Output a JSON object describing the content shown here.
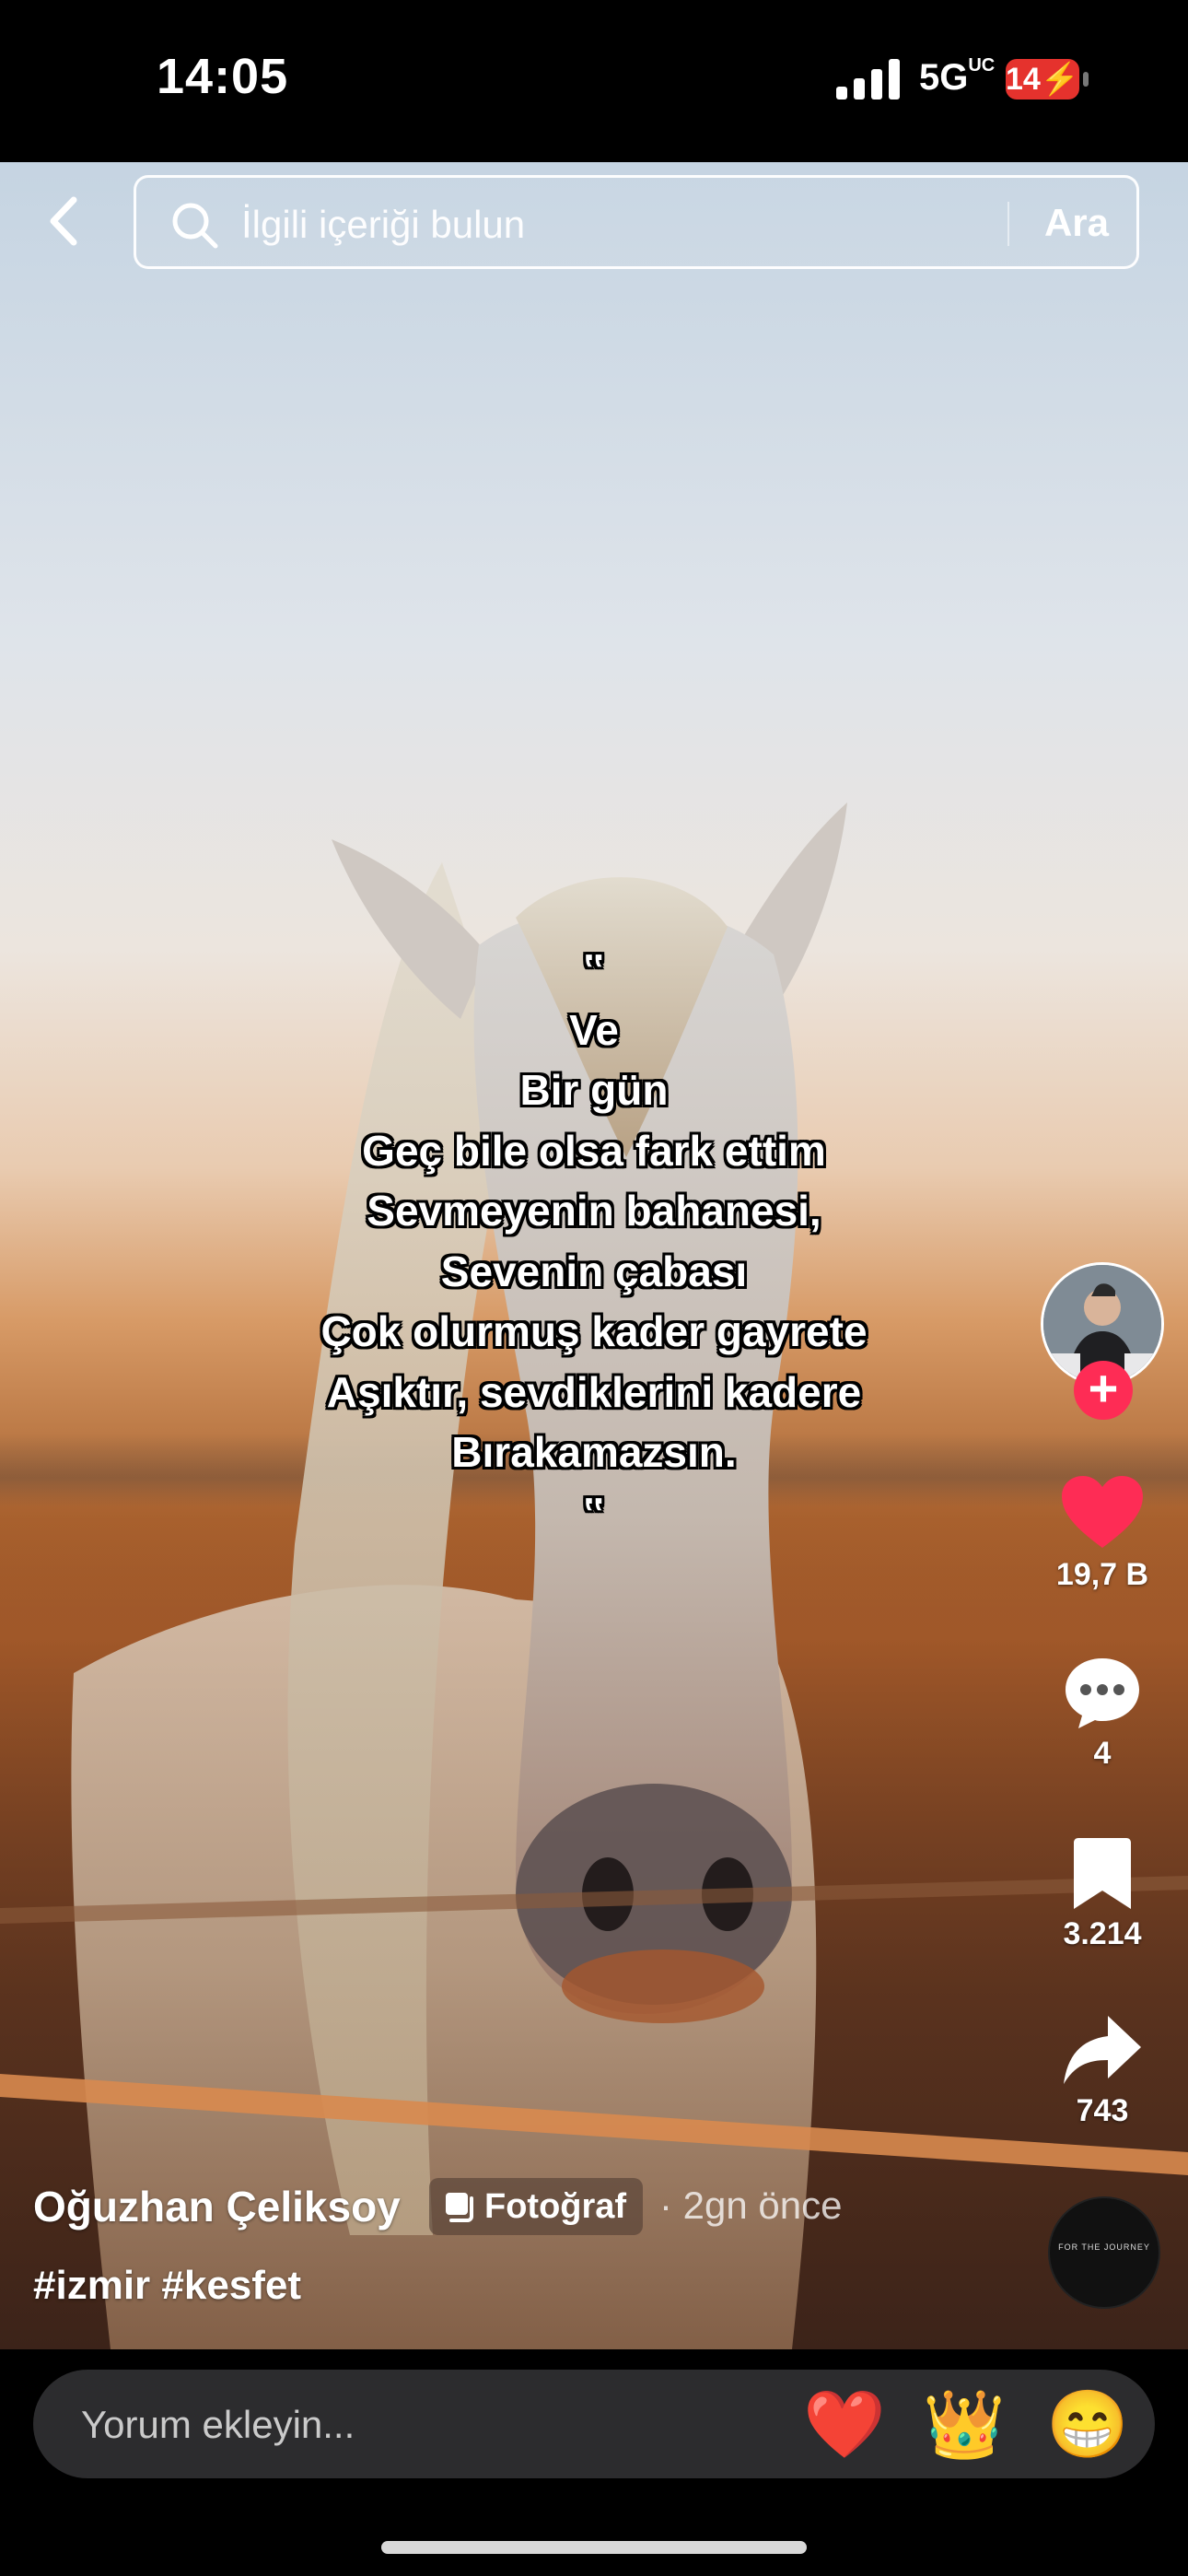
{
  "status_bar": {
    "time": "14:05",
    "network": "5G",
    "network_sup": "UC",
    "battery": "14"
  },
  "search": {
    "placeholder": "İlgili içeriği bulun",
    "button_label": "Ara"
  },
  "poem": {
    "lines": [
      "‟",
      "Ve",
      "Bir gün",
      "Geç bile olsa fark ettim",
      "Sevmeyenin bahanesi,",
      "Sevenin çabası",
      "Çok olurmuş kader gayrete",
      "Aşıktır, sevdiklerini kadere",
      "Bırakamazsın.",
      "‟"
    ]
  },
  "actions": {
    "follow_label": "+",
    "likes": "19,7 B",
    "comments": "4",
    "bookmarks": "3.214",
    "shares": "743"
  },
  "post": {
    "author": "Oğuzhan Çeliksoy",
    "type_badge": "Fotoğraf",
    "time_ago": "· 2gn önce",
    "hashtags": "#izmir #kesfet",
    "music_label": "FOR THE JOURNEY"
  },
  "comment_bar": {
    "placeholder": "Yorum ekleyin...",
    "emojis": [
      "❤️",
      "👑",
      "😁"
    ]
  },
  "colors": {
    "like_red": "#fe2c55",
    "battery_red": "#e5322d"
  }
}
